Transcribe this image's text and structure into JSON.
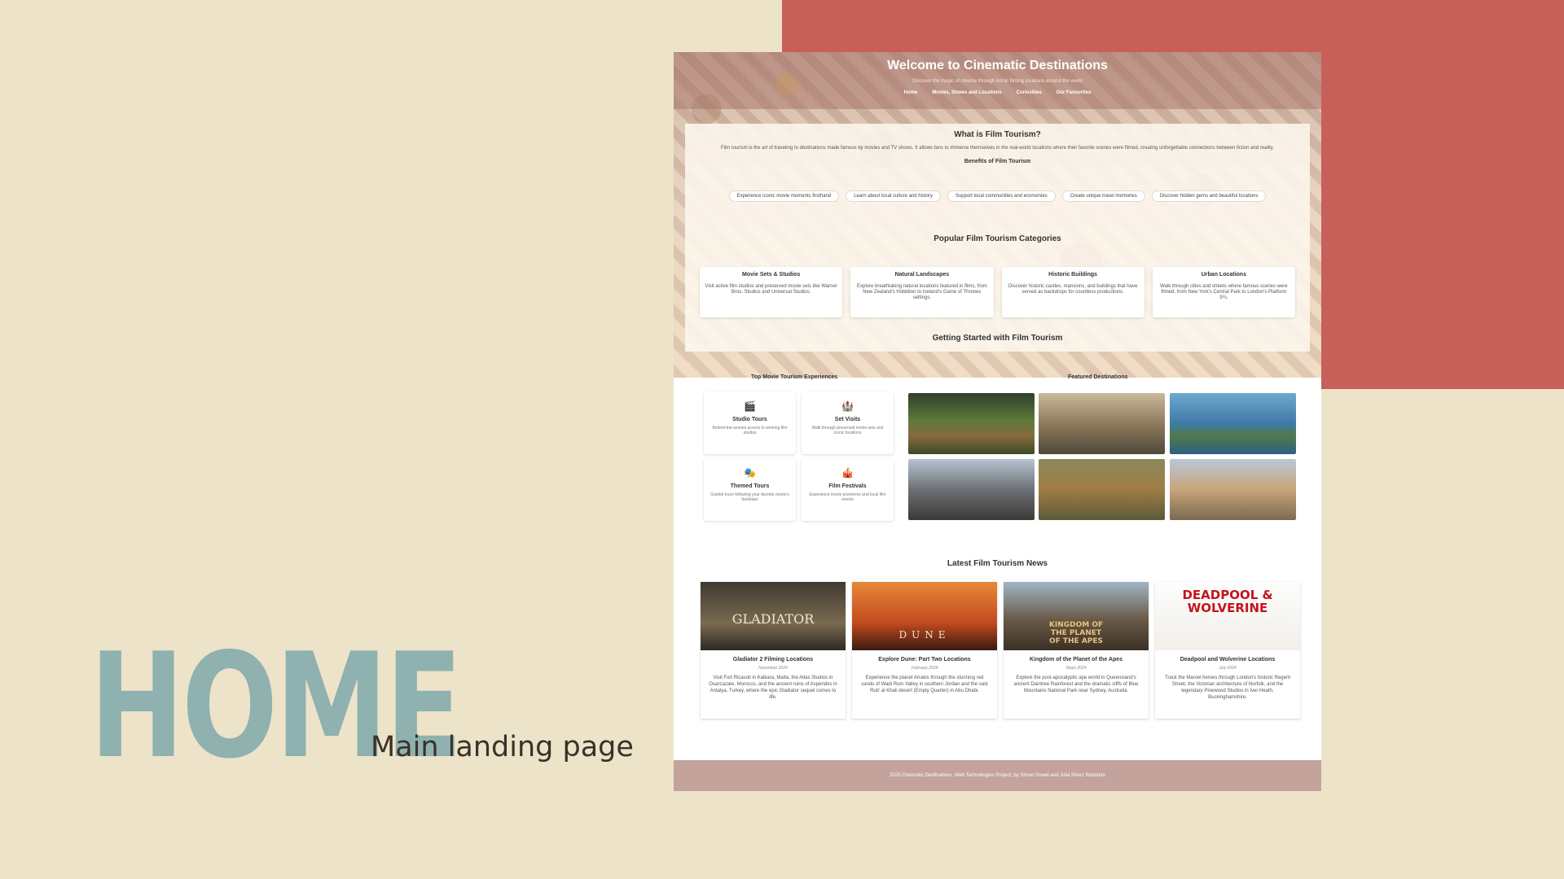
{
  "slide": {
    "title": "HOME",
    "subtitle": "Main landing page"
  },
  "site": {
    "header": {
      "title": "Welcome to Cinematic Destinations",
      "tagline": "Discover the magic of cinema through iconic filming locations around the world",
      "nav": [
        "Home",
        "Movies, Shows and Locations",
        "Curiosities",
        "Our Favourites"
      ]
    },
    "intro": {
      "heading": "What is Film Tourism?",
      "text": "Film tourism is the art of traveling to destinations made famous by movies and TV shows. It allows fans to immerse themselves in the real-world locations where their favorite scenes were filmed, creating unforgettable connections between fiction and reality.",
      "benefits_heading": "Benefits of Film Tourism",
      "benefits": [
        "Experience iconic movie moments firsthand",
        "Learn about local culture and history",
        "Support local communities and economies",
        "Create unique travel memories",
        "Discover hidden gems and beautiful locations"
      ]
    },
    "categories": {
      "heading": "Popular Film Tourism Categories",
      "items": [
        {
          "title": "Movie Sets & Studios",
          "text": "Visit active film studios and preserved movie sets like Warner Bros. Studios and Universal Studios."
        },
        {
          "title": "Natural Landscapes",
          "text": "Explore breathtaking natural locations featured in films, from New Zealand's Hobbiton to Iceland's Game of Thrones settings."
        },
        {
          "title": "Historic Buildings",
          "text": "Discover historic castles, mansions, and buildings that have served as backdrops for countless productions."
        },
        {
          "title": "Urban Locations",
          "text": "Walk through cities and streets where famous scenes were filmed, from New York's Central Park to London's Platform 9¾."
        }
      ]
    },
    "getting_started": {
      "heading": "Getting Started with Film Tourism",
      "experiences_heading": "Top Movie Tourism Experiences",
      "destinations_heading": "Featured Destinations",
      "experiences": [
        {
          "icon": "🎬",
          "title": "Studio Tours",
          "text": "Behind-the-scenes access to working film studios"
        },
        {
          "icon": "🏰",
          "title": "Set Visits",
          "text": "Walk through preserved movie sets and iconic locations"
        },
        {
          "icon": "🎭",
          "title": "Themed Tours",
          "text": "Guided tours following your favorite movie's footsteps"
        },
        {
          "icon": "🎪",
          "title": "Film Festivals",
          "text": "Experience movie premieres and local film events"
        }
      ]
    },
    "news": {
      "heading": "Latest Film Tourism News",
      "items": [
        {
          "poster_word": "GLADIATOR",
          "title": "Gladiator 2 Filming Locations",
          "date": "November 2024",
          "text": "Visit Fort Ricasoli in Kalkara, Malta, the Atlas Studios in Ouarzazate, Morocco, and the ancient ruins of Aspendos in Antalya, Turkey, where the epic Gladiator sequel comes to life."
        },
        {
          "poster_word": "DUNE",
          "title": "Explore Dune: Part Two Locations",
          "date": "February 2024",
          "text": "Experience the planet Arrakis through the stunning red sands of Wadi Rum Valley in southern Jordan and the vast Rub' al Khali desert (Empty Quarter) in Abu Dhabi."
        },
        {
          "poster_word": "KINGDOM OF THE PLANET OF THE APES",
          "title": "Kingdom of the Planet of the Apes",
          "date": "Mayo 2024",
          "text": "Explore the post-apocalyptic ape world in Queensland's ancient Daintree Rainforest and the dramatic cliffs of Blue Mountains National Park near Sydney, Australia."
        },
        {
          "poster_word": "DEADPOOL & WOLVERINE",
          "title": "Deadpool and Wolverine Locations",
          "date": "July 2024",
          "text": "Track the Marvel heroes through London's historic Regent Street, the Victorian architecture of Norfolk, and the legendary Pinewood Studios in Iver Heath, Buckinghamshire."
        }
      ]
    },
    "footer": "2025 Cinematic Destinations. Web Technologies Project, by Simon Dowel and Julia Pérez Redondo"
  }
}
